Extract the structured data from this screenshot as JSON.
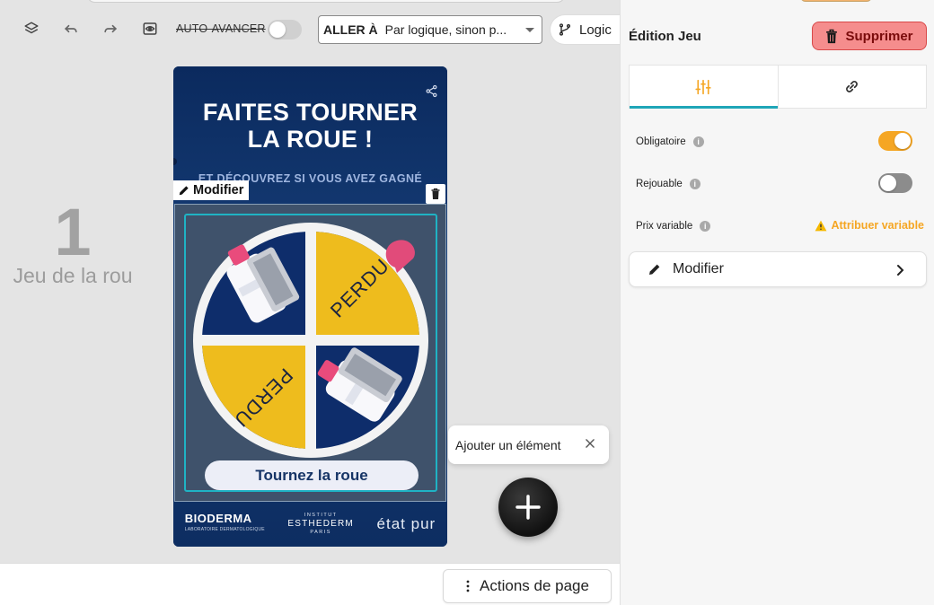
{
  "toolbar": {
    "icons": [
      "layers-icon",
      "undo-icon",
      "redo-icon",
      "preview-eye-icon"
    ],
    "auto_advance_label": "AUTO-AVANCER",
    "auto_advance_on": false,
    "goto_label": "ALLER À",
    "goto_value": "Par logique, sinon p...",
    "logic_button_label": "Logic"
  },
  "page": {
    "number": "1",
    "name": "Jeu de la rou"
  },
  "preview": {
    "headline_line1": "FAITES TOURNER",
    "headline_line2": "LA ROUE !",
    "subline": "ET DÉCOUVREZ SI VOUS AVEZ GAGNÉ",
    "modify_tag": "Modifier",
    "wheel_segments": [
      "PERDU",
      "PERDU"
    ],
    "spin_button": "Tournez la roue",
    "logos": {
      "brand1": "BIODERMA",
      "brand1_sub": "LABORATOIRE DERMATOLOGIQUE",
      "brand2_top": "INSTITUT",
      "brand2": "ESTHEDERM",
      "brand2_bottom": "PARIS",
      "brand3": "état pur"
    },
    "colors": {
      "navy": "#0b2a5e",
      "yellow": "#eebc1d",
      "accent": "#1fb3c4"
    }
  },
  "add_element": {
    "label": "Ajouter un élément"
  },
  "bottom": {
    "page_actions_label": "Actions de page"
  },
  "panel": {
    "title": "Édition Jeu",
    "delete_label": "Supprimer",
    "tabs": [
      "settings-sliders-icon",
      "link-icon"
    ],
    "active_tab": 0,
    "fields": [
      {
        "label": "Obligatoire",
        "toggle": true
      },
      {
        "label": "Rejouable",
        "toggle": false
      },
      {
        "label": "Prix variable",
        "action": "Attribuer variable"
      }
    ],
    "modify_label": "Modifier",
    "accent_color": "#1fa6b8",
    "delete_color": "#f58d8d"
  }
}
